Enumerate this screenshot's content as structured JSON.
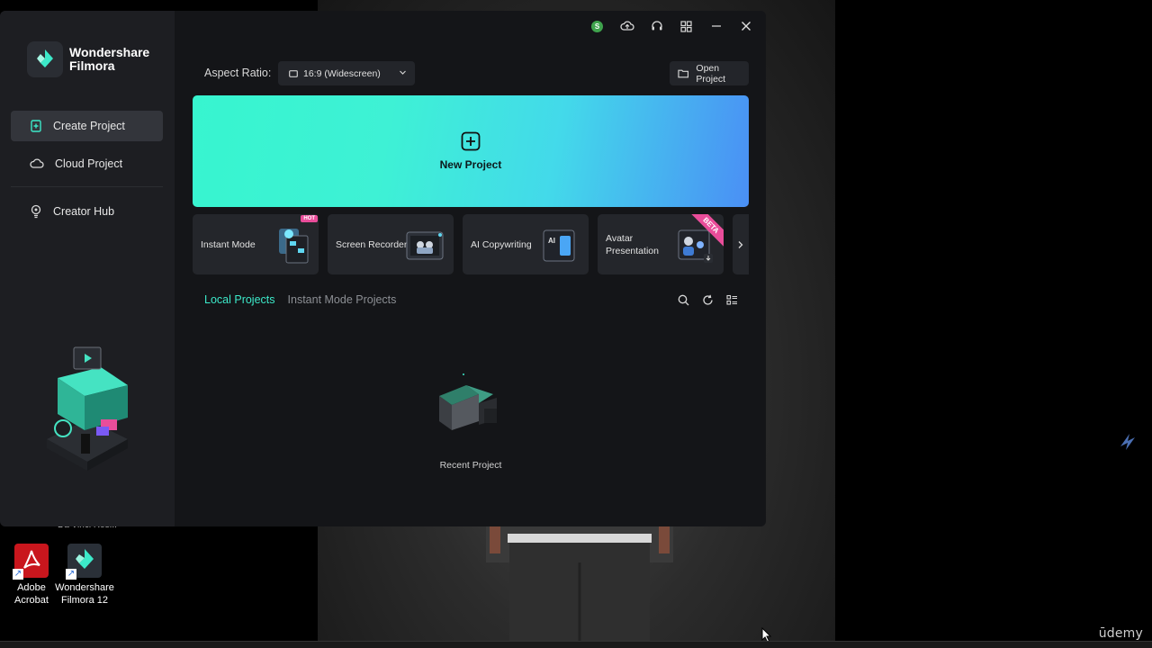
{
  "app": {
    "brand_line1": "Wondershare",
    "brand_line2": "Filmora"
  },
  "sidebar": {
    "items": [
      {
        "label": "Create Project",
        "icon": "add-file-icon",
        "active": true
      },
      {
        "label": "Cloud Project",
        "icon": "cloud-icon",
        "active": false
      },
      {
        "label": "Creator Hub",
        "icon": "lightbulb-icon",
        "active": false
      }
    ]
  },
  "titlebar": {
    "avatar_letter": "S",
    "icons": [
      "cloud-upload-icon",
      "headset-icon",
      "grid-icon",
      "minimize-icon",
      "close-icon"
    ]
  },
  "toolbar": {
    "aspect_label": "Aspect Ratio:",
    "aspect_value": "16:9 (Widescreen)",
    "open_project_label": "Open Project"
  },
  "new_project": {
    "label": "New Project",
    "icon": "plus-square-icon"
  },
  "feature_cards": [
    {
      "label": "Instant Mode",
      "badge": "HOT"
    },
    {
      "label": "Screen Recorder",
      "badge": ""
    },
    {
      "label": "AI Copywriting",
      "badge": ""
    },
    {
      "label": "Avatar Presentation",
      "badge": "BETA"
    }
  ],
  "projects": {
    "tabs": [
      {
        "label": "Local Projects",
        "active": true
      },
      {
        "label": "Instant Mode Projects",
        "active": false
      }
    ],
    "empty_label": "Recent Project"
  },
  "desktop": {
    "partial_label": "Da Vinci Res...",
    "icons": [
      {
        "label_line1": "Adobe",
        "label_line2": "Acrobat"
      },
      {
        "label_line1": "Wondershare",
        "label_line2": "Filmora 12"
      }
    ],
    "watermark": "ūdemy"
  },
  "colors": {
    "accent": "#3ce9c9",
    "banner_start": "#37f5cf",
    "banner_end": "#4a8ff5",
    "badge": "#e94d9a",
    "sidebar_bg": "#1d1e22",
    "window_bg": "#141518"
  }
}
